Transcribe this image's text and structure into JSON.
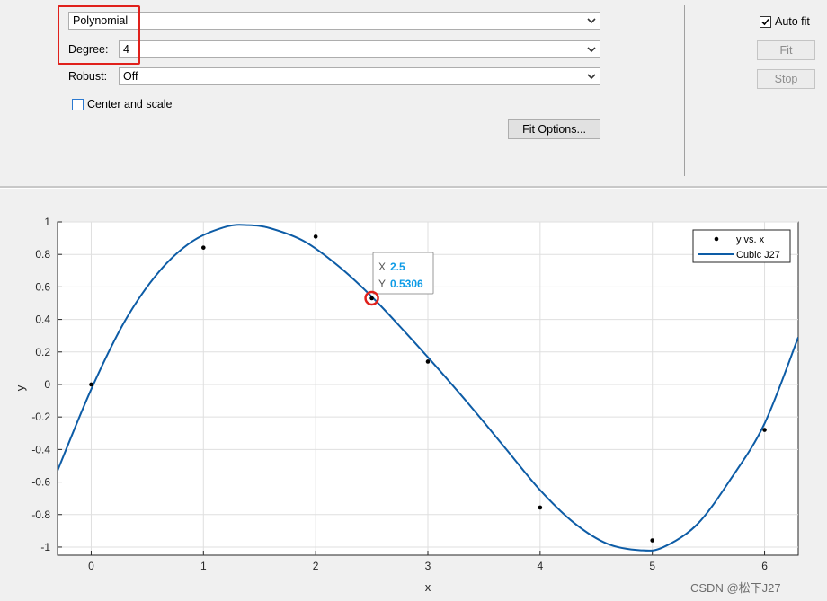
{
  "fit_panel": {
    "fit_type": "Polynomial",
    "degree_label": "Degree:",
    "degree_value": "4",
    "robust_label": "Robust:",
    "robust_value": "Off",
    "center_scale_label": "Center and scale",
    "center_scale_checked": false,
    "fit_options_label": "Fit Options..."
  },
  "controls": {
    "auto_fit_label": "Auto fit",
    "auto_fit_checked": true,
    "fit_label": "Fit",
    "stop_label": "Stop"
  },
  "chart_data": {
    "type": "scatter",
    "xlabel": "x",
    "ylabel": "y",
    "xlim": [
      -0.3,
      6.3
    ],
    "ylim": [
      -1.05,
      1
    ],
    "x_ticks": [
      "0",
      "1",
      "2",
      "3",
      "4",
      "5",
      "6"
    ],
    "y_ticks": [
      "1",
      "0.8",
      "0.6",
      "0.4",
      "0.2",
      "0",
      "-0.2",
      "-0.4",
      "-0.6",
      "-0.8",
      "-1"
    ],
    "grid": true,
    "legend_position": "top-right",
    "series": [
      {
        "name": "y vs. x",
        "type": "scatter",
        "x": [
          0,
          1,
          2,
          2.5,
          3,
          4,
          5,
          6
        ],
        "y": [
          0,
          0.8415,
          0.9093,
          0.5306,
          0.1411,
          -0.7568,
          -0.9589,
          -0.2794
        ],
        "color": "#000000"
      },
      {
        "name": "Cubic J27",
        "type": "line",
        "x": [
          -0.3,
          0.0,
          0.3,
          0.6,
          0.9,
          1.2,
          1.4,
          1.6,
          1.9,
          2.2,
          2.5,
          2.8,
          3.1,
          3.4,
          3.7,
          4.0,
          4.3,
          4.6,
          4.9,
          5.1,
          5.4,
          5.7,
          6.0,
          6.3
        ],
        "y": [
          -0.53,
          -0.03,
          0.39,
          0.69,
          0.88,
          0.97,
          0.98,
          0.96,
          0.88,
          0.73,
          0.54,
          0.32,
          0.09,
          -0.15,
          -0.4,
          -0.65,
          -0.85,
          -0.98,
          -1.02,
          -1.0,
          -0.86,
          -0.58,
          -0.24,
          0.29
        ],
        "color": "#0d5ca6"
      }
    ],
    "datatip": {
      "x_label": "X",
      "x_value": "2.5",
      "y_label": "Y",
      "y_value": "0.5306",
      "point": [
        2.5,
        0.5306
      ]
    }
  },
  "watermark": "CSDN @松下J27"
}
